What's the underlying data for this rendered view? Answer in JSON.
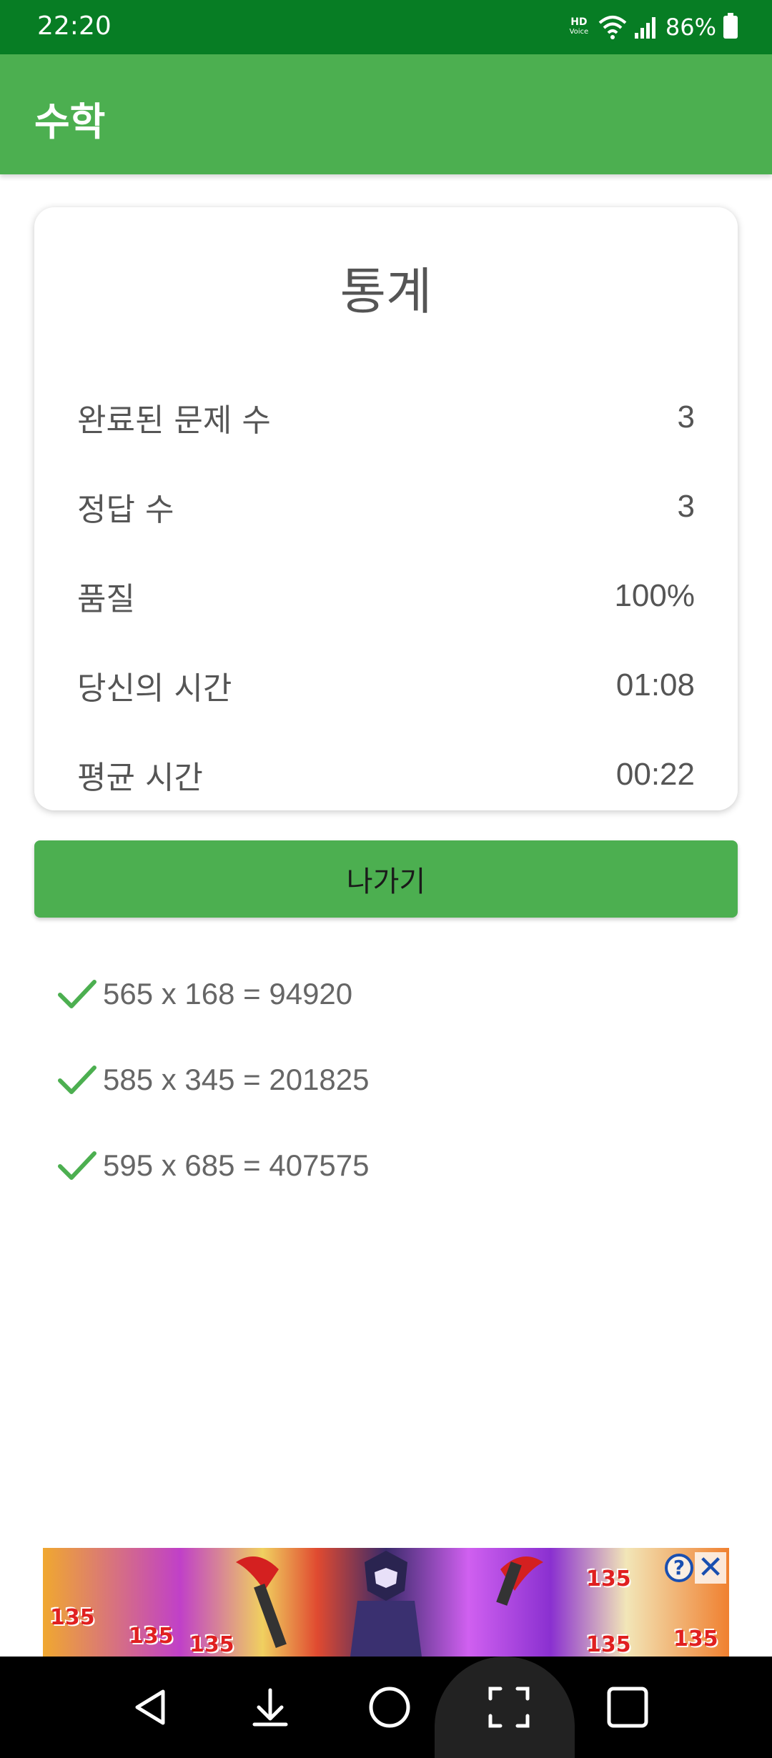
{
  "status_bar": {
    "time": "22:20",
    "hd_voice_label": "HD",
    "hd_voice_sub": "Voice",
    "battery": "86%",
    "icons": [
      "hd-voice-icon",
      "wifi-icon",
      "signal-icon",
      "battery-icon"
    ]
  },
  "app_bar": {
    "title": "수학"
  },
  "stats": {
    "title": "통계",
    "rows": [
      {
        "label": "완료된 문제 수",
        "value": "3"
      },
      {
        "label": "정답 수",
        "value": "3"
      },
      {
        "label": "품질",
        "value": "100%"
      },
      {
        "label": "당신의 시간",
        "value": "01:08"
      },
      {
        "label": "평균 시간",
        "value": "00:22"
      }
    ]
  },
  "exit_button": {
    "label": "나가기"
  },
  "results": [
    {
      "text": "565 x 168 = 94920",
      "status": "correct"
    },
    {
      "text": "585 x 345 = 201825",
      "status": "correct"
    },
    {
      "text": "595 x 685 = 407575",
      "status": "correct"
    }
  ],
  "ad": {
    "numbers": [
      "135",
      "135",
      "135",
      "135",
      "135",
      "135"
    ],
    "info_symbol": "?",
    "close_symbol": "✕"
  },
  "nav_bar": {
    "buttons": [
      "back-icon",
      "download-icon",
      "home-icon",
      "screenshot-icon",
      "recents-icon"
    ]
  },
  "colors": {
    "status_bar": "#077d24",
    "app_bar": "#4caf50",
    "check": "#4caf50",
    "text": "#555555"
  }
}
